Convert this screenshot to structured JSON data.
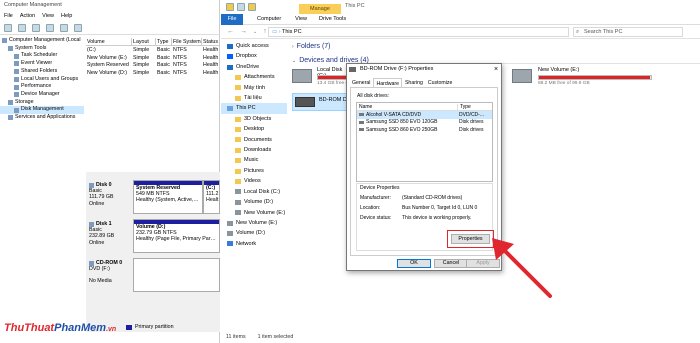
{
  "computer_management": {
    "title": "Computer Management",
    "menu": [
      "File",
      "Action",
      "View",
      "Help"
    ],
    "tree": [
      {
        "label": "Computer Management (Local",
        "indent": 0
      },
      {
        "label": "System Tools",
        "indent": 1
      },
      {
        "label": "Task Scheduler",
        "indent": 2
      },
      {
        "label": "Event Viewer",
        "indent": 2
      },
      {
        "label": "Shared Folders",
        "indent": 2
      },
      {
        "label": "Local Users and Groups",
        "indent": 2
      },
      {
        "label": "Performance",
        "indent": 2
      },
      {
        "label": "Device Manager",
        "indent": 2
      },
      {
        "label": "Storage",
        "indent": 1
      },
      {
        "label": "Disk Management",
        "indent": 2,
        "selected": true
      },
      {
        "label": "Services and Applications",
        "indent": 1
      }
    ],
    "volume_headers": [
      "Volume",
      "Layout",
      "Type",
      "File System",
      "Status"
    ],
    "volumes": [
      [
        "(C:)",
        "Simple",
        "Basic",
        "NTFS",
        "Health"
      ],
      [
        "New Volume (E:)",
        "Simple",
        "Basic",
        "NTFS",
        "Health"
      ],
      [
        "System Reserved",
        "Simple",
        "Basic",
        "NTFS",
        "Health"
      ],
      [
        "New Volume (D:)",
        "Simple",
        "Basic",
        "NTFS",
        "Health"
      ]
    ],
    "disk0": {
      "name": "Disk 0",
      "type": "Basic",
      "size": "111.79 GB",
      "state": "Online",
      "p1": {
        "name": "System Reserved",
        "size": "549 MB NTFS",
        "status": "Healthy (System, Active, Pr"
      },
      "p2": {
        "name": "(C:)",
        "size": "111.2",
        "status": "Healt"
      }
    },
    "disk1": {
      "name": "Disk 1",
      "type": "Basic",
      "size": "232.89 GB",
      "state": "Online",
      "p1": {
        "name": "Volume (D:)",
        "size": "232.79 GB NTFS",
        "status": "Healthy (Page File, Primary Partition)"
      }
    },
    "cdrom": {
      "name": "CD-ROM 0",
      "type": "DVD (F:)",
      "state": "No Media"
    },
    "legend": "Primary partition"
  },
  "explorer": {
    "window_title": "This PC",
    "manage_tab": "Manage",
    "ribbon_tabs": [
      "File",
      "Computer",
      "View",
      "Drive Tools"
    ],
    "address": "This PC",
    "search_placeholder": "Search This PC",
    "nav": [
      {
        "label": "Quick access",
        "icon": "star-icon"
      },
      {
        "label": "Dropbox",
        "icon": "dropbox-icon"
      },
      {
        "label": "OneDrive",
        "icon": "cloud-icon"
      },
      {
        "label": "Attachments",
        "icon": "folder-icon",
        "sub": true
      },
      {
        "label": "Máy tính",
        "icon": "folder-icon",
        "sub": true
      },
      {
        "label": "Tài liệu",
        "icon": "folder-icon",
        "sub": true
      },
      {
        "label": "This PC",
        "icon": "computer-icon",
        "selected": true
      },
      {
        "label": "3D Objects",
        "icon": "folder-icon",
        "sub": true
      },
      {
        "label": "Desktop",
        "icon": "folder-icon",
        "sub": true
      },
      {
        "label": "Documents",
        "icon": "folder-icon",
        "sub": true
      },
      {
        "label": "Downloads",
        "icon": "folder-icon",
        "sub": true
      },
      {
        "label": "Music",
        "icon": "folder-icon",
        "sub": true
      },
      {
        "label": "Pictures",
        "icon": "folder-icon",
        "sub": true
      },
      {
        "label": "Videos",
        "icon": "folder-icon",
        "sub": true
      },
      {
        "label": "Local Disk (C:)",
        "icon": "drive-icon",
        "sub": true
      },
      {
        "label": "Volume (D:)",
        "icon": "drive-icon",
        "sub": true
      },
      {
        "label": "New Volume (E:)",
        "icon": "drive-icon",
        "sub": true
      },
      {
        "label": "New Volume (E:)",
        "icon": "drive-icon"
      },
      {
        "label": "Volume (D:)",
        "icon": "drive-icon"
      },
      {
        "label": "Network",
        "icon": "network-icon"
      }
    ],
    "folders_group": "Folders (7)",
    "drives_group": "Devices and drives (4)",
    "drive_c": {
      "name": "Local Disk (C:)",
      "free": "13.4 GB free of 111 GB",
      "fill": 0.88
    },
    "drive_e": {
      "name": "New Volume (E:)",
      "free": "88.2 MB free of 99.9 GB",
      "fill": 0.99
    },
    "bdrom": "BD-ROM Drive",
    "status_items": "11 items",
    "status_selected": "1 item selected"
  },
  "dialog": {
    "title": "BD-ROM Drive (F:) Properties",
    "tabs": [
      "General",
      "Hardware",
      "Sharing",
      "Customize"
    ],
    "all_disks_label": "All disk drives:",
    "list_headers": [
      "Name",
      "Type"
    ],
    "drives": [
      {
        "name": "Alcohol V-SATA CD/DVD",
        "type": "DVD/CD-..."
      },
      {
        "name": "Samsung SSD 850 EVO 120GB",
        "type": "Disk drives"
      },
      {
        "name": "Samsung SSD 860 EVO 250GB",
        "type": "Disk drives"
      }
    ],
    "device_properties": "Device Properties",
    "manufacturer_label": "Manufacturer:",
    "manufacturer": "(Standard CD-ROM drives)",
    "location_label": "Location:",
    "location": "Bus Number 0, Target Id 0, LUN 0",
    "status_label": "Device status:",
    "status": "This device is working properly.",
    "properties_btn": "Properties",
    "ok": "OK",
    "cancel": "Cancel",
    "apply": "Apply"
  },
  "watermark": {
    "part1": "ThuThuat",
    "part2": "PhanMem",
    ".vn": ".vn",
    "color1": "#e0272f",
    "color2": "#1f4fa8"
  }
}
